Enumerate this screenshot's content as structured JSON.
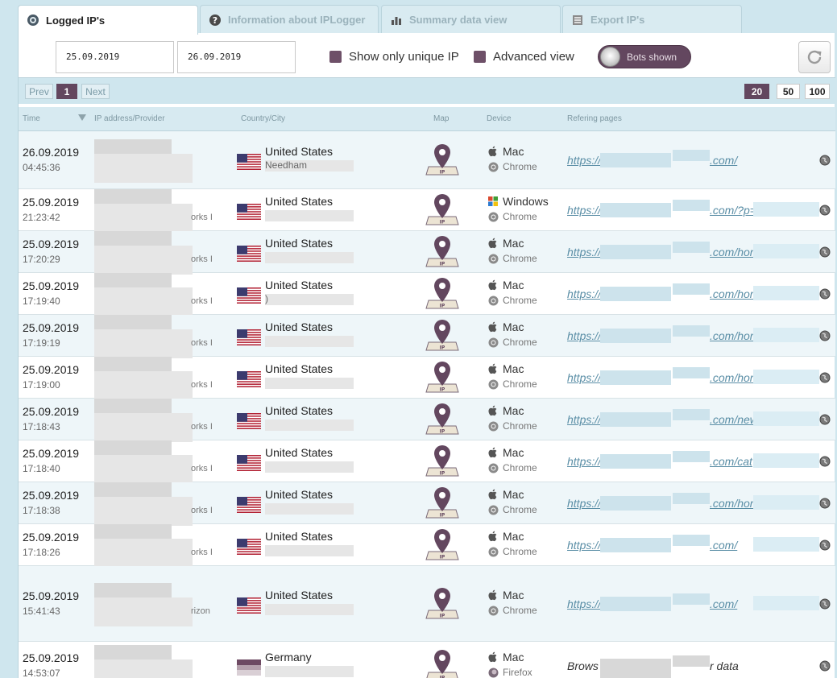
{
  "tabs": [
    {
      "label": "Logged IP's",
      "icon": "eye-icon",
      "active": true
    },
    {
      "label": "Information about IPLogger",
      "icon": "question-icon",
      "active": false
    },
    {
      "label": "Summary data view",
      "icon": "bar-chart-icon",
      "active": false
    },
    {
      "label": "Export IP's",
      "icon": "export-icon",
      "active": false
    }
  ],
  "filters": {
    "date_from": "25.09.2019",
    "date_to": "26.09.2019",
    "unique_label": "Show only unique IP",
    "advanced_label": "Advanced view",
    "bots_label": "Bots shown"
  },
  "pager": {
    "prev": "Prev",
    "current": "1",
    "next": "Next",
    "sizes": [
      "20",
      "50",
      "100"
    ],
    "selected_size": "20"
  },
  "columns": {
    "time": "Time",
    "ip": "IP address/Provider",
    "country": "Country/City",
    "map": "Map",
    "device": "Device",
    "ref": "Refering pages"
  },
  "colors": {
    "accent": "#63475f",
    "header_bg": "#cfe6ee",
    "link": "#5a8ea6"
  },
  "rows": [
    {
      "date": "26.09.2019",
      "time": "04:45:36",
      "isp": "",
      "country": "United States",
      "city": "Needham",
      "os": "Mac",
      "browser": "Chrome",
      "ref": "https://",
      "ref_tail": ".com/",
      "ref_link": true,
      "flag": "us"
    },
    {
      "date": "25.09.2019",
      "time": "21:23:42",
      "isp": "orks I",
      "country": "United States",
      "city": "",
      "os": "Windows",
      "browser": "Chrome",
      "ref": "https://",
      "ref_tail": ".com/?p=",
      "ref_link": true,
      "flag": "us"
    },
    {
      "date": "25.09.2019",
      "time": "17:20:29",
      "isp": "orks I",
      "country": "United States",
      "city": "",
      "os": "Mac",
      "browser": "Chrome",
      "ref": "https://",
      "ref_tail": ".com/hor",
      "ref_link": true,
      "flag": "us"
    },
    {
      "date": "25.09.2019",
      "time": "17:19:40",
      "isp": "orks I",
      "country": "United States",
      "city": ")",
      "os": "Mac",
      "browser": "Chrome",
      "ref": "https://",
      "ref_tail": ".com/hor",
      "ref_link": true,
      "flag": "us"
    },
    {
      "date": "25.09.2019",
      "time": "17:19:19",
      "isp": "orks I",
      "country": "United States",
      "city": "",
      "os": "Mac",
      "browser": "Chrome",
      "ref": "https://",
      "ref_tail": ".com/hor",
      "ref_link": true,
      "flag": "us"
    },
    {
      "date": "25.09.2019",
      "time": "17:19:00",
      "isp": "orks I",
      "country": "United States",
      "city": "",
      "os": "Mac",
      "browser": "Chrome",
      "ref": "https://",
      "ref_tail": ".com/hor",
      "ref_link": true,
      "flag": "us"
    },
    {
      "date": "25.09.2019",
      "time": "17:18:43",
      "isp": "orks I",
      "country": "United States",
      "city": "",
      "os": "Mac",
      "browser": "Chrome",
      "ref": "https://",
      "ref_tail": ".com/new",
      "ref_link": true,
      "flag": "us"
    },
    {
      "date": "25.09.2019",
      "time": "17:18:40",
      "isp": "orks I",
      "country": "United States",
      "city": "",
      "os": "Mac",
      "browser": "Chrome",
      "ref": "https://",
      "ref_tail": ".com/cat",
      "ref_link": true,
      "flag": "us"
    },
    {
      "date": "25.09.2019",
      "time": "17:18:38",
      "isp": "orks I",
      "country": "United States",
      "city": "",
      "os": "Mac",
      "browser": "Chrome",
      "ref": "https://",
      "ref_tail": ".com/hor",
      "ref_link": true,
      "flag": "us"
    },
    {
      "date": "25.09.2019",
      "time": "17:18:26",
      "isp": "orks I",
      "country": "United States",
      "city": "",
      "os": "Mac",
      "browser": "Chrome",
      "ref": "https://",
      "ref_tail": ".com/",
      "ref_link": true,
      "flag": "us"
    },
    {
      "date": "25.09.2019",
      "time": "15:41:43",
      "isp": "rizon",
      "country": "United States",
      "city": "",
      "os": "Mac",
      "browser": "Chrome",
      "ref": "https://",
      "ref_tail": ".com/",
      "ref_link": true,
      "flag": "us"
    },
    {
      "date": "25.09.2019",
      "time": "14:53:07",
      "isp": "",
      "country": "Germany",
      "city": "",
      "os": "Mac",
      "browser": "Firefox",
      "ref": "Brows",
      "ref_tail": "r data",
      "ref_link": false,
      "flag": "de"
    }
  ]
}
